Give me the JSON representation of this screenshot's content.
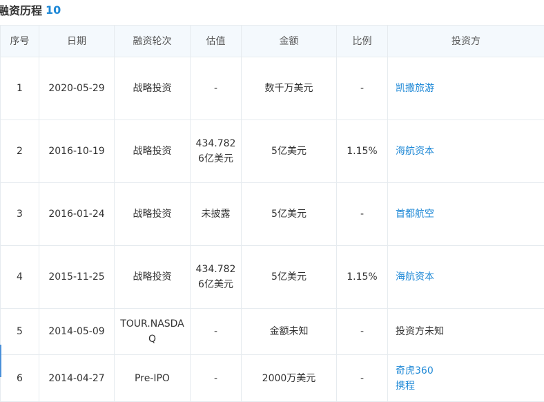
{
  "section": {
    "title": "融资历程",
    "count": "10"
  },
  "table": {
    "headers": [
      "序号",
      "日期",
      "融资轮次",
      "估值",
      "金额",
      "比例",
      "投资方"
    ],
    "rows": [
      {
        "no": "1",
        "date": "2020-05-29",
        "round": "战略投资",
        "valuation": "-",
        "amount": "数千万美元",
        "ratio": "-",
        "investors": [
          {
            "name": "凯撒旅游",
            "link": true
          }
        ]
      },
      {
        "no": "2",
        "date": "2016-10-19",
        "round": "战略投资",
        "valuation": "434.7826亿美元",
        "amount": "5亿美元",
        "ratio": "1.15%",
        "investors": [
          {
            "name": "海航资本",
            "link": true
          }
        ]
      },
      {
        "no": "3",
        "date": "2016-01-24",
        "round": "战略投资",
        "valuation": "未披露",
        "amount": "5亿美元",
        "ratio": "-",
        "investors": [
          {
            "name": "首都航空",
            "link": true
          }
        ]
      },
      {
        "no": "4",
        "date": "2015-11-25",
        "round": "战略投资",
        "valuation": "434.7826亿美元",
        "amount": "5亿美元",
        "ratio": "1.15%",
        "investors": [
          {
            "name": "海航资本",
            "link": true
          }
        ]
      },
      {
        "no": "5",
        "date": "2014-05-09",
        "round": "TOUR.NASDAQ",
        "valuation": "-",
        "amount": "金额未知",
        "ratio": "-",
        "investors": [
          {
            "name": "投资方未知",
            "link": false
          }
        ]
      },
      {
        "no": "6",
        "date": "2014-04-27",
        "round": "Pre-IPO",
        "valuation": "-",
        "amount": "2000万美元",
        "ratio": "-",
        "investors": [
          {
            "name": "奇虎360",
            "link": true
          },
          {
            "name": "携程",
            "link": true
          }
        ]
      }
    ]
  },
  "colors": {
    "accent": "#1e88d6",
    "header_bg": "#f4f9fd",
    "border": "#e6ebef"
  }
}
